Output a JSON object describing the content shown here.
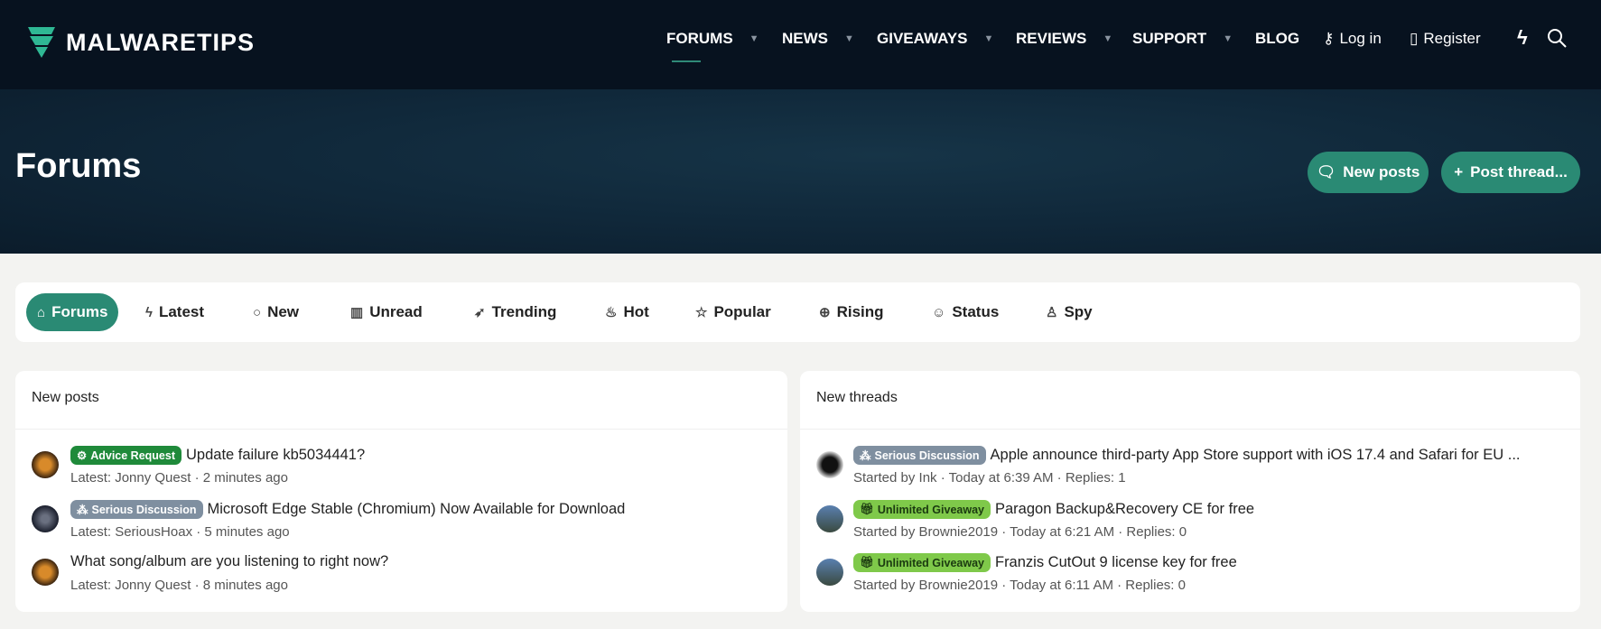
{
  "header": {
    "logo_text": "MALWARETIPS",
    "nav": [
      {
        "label": "FORUMS"
      },
      {
        "label": "NEWS"
      },
      {
        "label": "GIVEAWAYS"
      },
      {
        "label": "REVIEWS"
      },
      {
        "label": "SUPPORT"
      },
      {
        "label": "BLOG"
      }
    ],
    "login": "Log in",
    "register": "Register"
  },
  "banner": {
    "title": "Forums",
    "new_posts": "New posts",
    "post_thread": "Post thread..."
  },
  "tabs": [
    {
      "label": "Forums",
      "icon": "⌂"
    },
    {
      "label": "Latest",
      "icon": "ϟ"
    },
    {
      "label": "New",
      "icon": "○"
    },
    {
      "label": "Unread",
      "icon": "▥"
    },
    {
      "label": "Trending",
      "icon": "➶"
    },
    {
      "label": "Hot",
      "icon": "♨"
    },
    {
      "label": "Popular",
      "icon": "☆"
    },
    {
      "label": "Rising",
      "icon": "⊕"
    },
    {
      "label": "Status",
      "icon": "☺"
    },
    {
      "label": "Spy",
      "icon": "♙"
    }
  ],
  "new_posts": {
    "heading": "New posts",
    "items": [
      {
        "badge": "Advice Request",
        "badge_color": "#1f8a3a",
        "title": "Update failure kb5034441?",
        "meta": "Latest: Jonny Quest · 2 minutes ago"
      },
      {
        "badge": "Serious Discussion",
        "badge_color": "#7f8fa0",
        "title": "Microsoft Edge Stable (Chromium) Now Available for Download",
        "meta": "Latest: SeriousHoax · 5 minutes ago"
      },
      {
        "badge": null,
        "title": "What song/album are you listening to right now?",
        "meta": "Latest: Jonny Quest · 8 minutes ago"
      }
    ]
  },
  "new_threads": {
    "heading": "New threads",
    "items": [
      {
        "badge": "Serious Discussion",
        "badge_color": "#7f8fa0",
        "title": "Apple announce third-party App Store support with iOS 17.4 and Safari for EU ...",
        "meta": "Started by Ink · Today at 6:39 AM · Replies: 1"
      },
      {
        "badge": "Unlimited Giveaway",
        "badge_color": "#7fc94a",
        "title": "Paragon Backup&Recovery CE for free",
        "meta": "Started by Brownie2019 · Today at 6:21 AM · Replies: 0"
      },
      {
        "badge": "Unlimited Giveaway",
        "badge_color": "#7fc94a",
        "title": "Franzis CutOut 9 license key for free",
        "meta": "Started by Brownie2019 · Today at 6:11 AM · Replies: 0"
      }
    ]
  }
}
